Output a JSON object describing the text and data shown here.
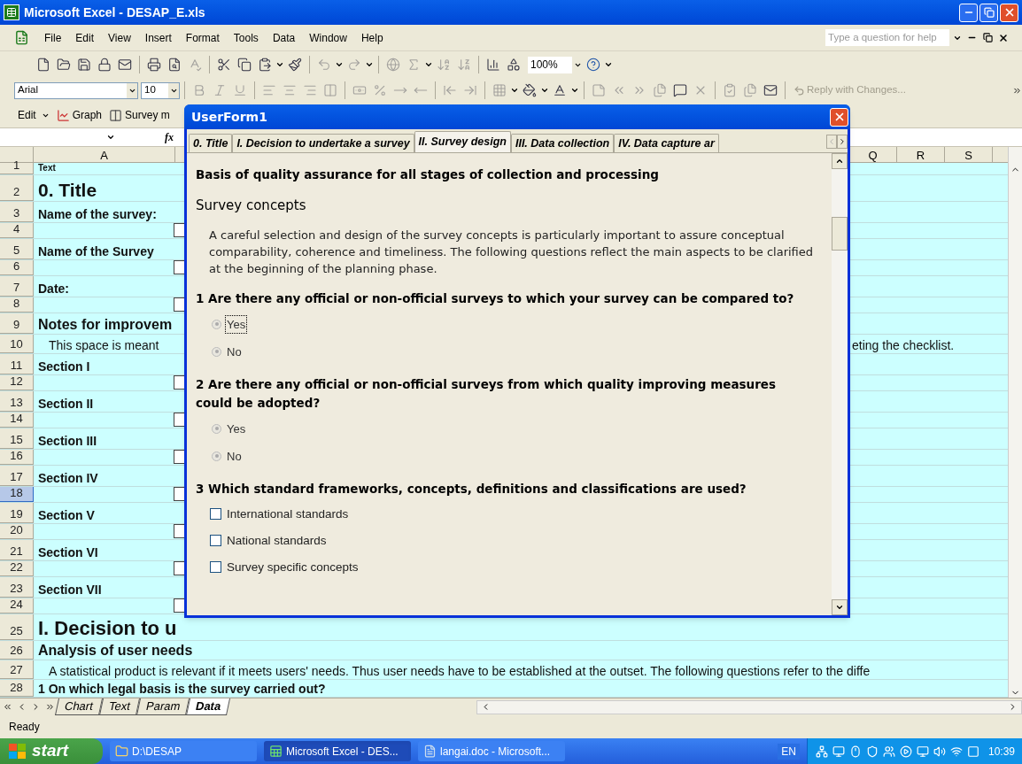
{
  "window": {
    "title": "Microsoft Excel - DESAP_E.xls"
  },
  "menu": [
    "File",
    "Edit",
    "View",
    "Insert",
    "Format",
    "Tools",
    "Data",
    "Window",
    "Help"
  ],
  "help_box": {
    "placeholder": "Type a question for help"
  },
  "standard_toolbar": {
    "zoom": "100%"
  },
  "formatting_toolbar": {
    "font": "Arial",
    "size": "10",
    "review_button": "Reply with Changes..."
  },
  "custom_toolbar": [
    {
      "kind": "menu",
      "label": "Edit"
    },
    {
      "kind": "graph",
      "label": "Graph"
    },
    {
      "kind": "survey",
      "label": "Survey m"
    }
  ],
  "formula_bar": {
    "fx": "fx"
  },
  "columns_left": [
    "A"
  ],
  "columns_right": [
    "Q",
    "R",
    "S"
  ],
  "rows": [
    {
      "number": "1",
      "kind": "small",
      "text": "Text",
      "selected": false
    },
    {
      "number": "2",
      "kind": "title",
      "text": "0. Title",
      "selected": false
    },
    {
      "number": "3",
      "kind": "label",
      "text": "Name of the survey:",
      "selected": false
    },
    {
      "number": "4",
      "kind": "box",
      "checked": false,
      "selected": false
    },
    {
      "number": "5",
      "kind": "label",
      "text": "Name of the Survey",
      "selected": false
    },
    {
      "number": "6",
      "kind": "box",
      "checked": false,
      "selected": false
    },
    {
      "number": "7",
      "kind": "label",
      "text": "Date:",
      "selected": false
    },
    {
      "number": "8",
      "kind": "box",
      "checked": false,
      "selected": false
    },
    {
      "number": "9",
      "kind": "subheading",
      "text": "Notes for improvem",
      "selected": false
    },
    {
      "number": "10",
      "kind": "text",
      "text": "This space is meant",
      "right_text": "eting the checklist.",
      "selected": false
    },
    {
      "number": "11",
      "kind": "label",
      "text": "Section I",
      "selected": false
    },
    {
      "number": "12",
      "kind": "box",
      "checked": false,
      "selected": false
    },
    {
      "number": "13",
      "kind": "label",
      "text": "Section II",
      "selected": false
    },
    {
      "number": "14",
      "kind": "box",
      "checked": false,
      "selected": false
    },
    {
      "number": "15",
      "kind": "label",
      "text": "Section III",
      "selected": false
    },
    {
      "number": "16",
      "kind": "box",
      "checked": false,
      "selected": false
    },
    {
      "number": "17",
      "kind": "label",
      "text": "Section IV",
      "selected": false
    },
    {
      "number": "18",
      "kind": "box",
      "checked": false,
      "selected": true
    },
    {
      "number": "19",
      "kind": "label",
      "text": "Section V",
      "selected": false
    },
    {
      "number": "20",
      "kind": "box",
      "checked": false,
      "selected": false
    },
    {
      "number": "21",
      "kind": "label",
      "text": "Section VI",
      "selected": false
    },
    {
      "number": "22",
      "kind": "box",
      "checked": false,
      "selected": false
    },
    {
      "number": "23",
      "kind": "label",
      "text": "Section VII",
      "selected": false
    },
    {
      "number": "24",
      "kind": "box",
      "checked": false,
      "selected": false
    },
    {
      "number": "25",
      "kind": "section",
      "text": "I. Decision to u",
      "selected": false
    },
    {
      "number": "26",
      "kind": "wide_heading",
      "text": "Analysis of user needs",
      "selected": false
    },
    {
      "number": "27",
      "kind": "wide_text",
      "text": "A statistical product is relevant if it meets users' needs. Thus user needs have to be established at the outset. The following questions refer to the diffe",
      "selected": false
    },
    {
      "number": "28",
      "kind": "wide_question",
      "text": "1 On which legal basis is the survey carried out?",
      "selected": false
    }
  ],
  "dialog": {
    "title": "UserForm1",
    "tabs": [
      {
        "label": "0. Title",
        "selected": false
      },
      {
        "label": "I. Decision to undertake a survey",
        "selected": false
      },
      {
        "label": "II. Survey design",
        "selected": true
      },
      {
        "label": "III. Data collection",
        "selected": false
      },
      {
        "label": "IV. Data capture ar",
        "selected": false
      }
    ],
    "items": [
      {
        "kind": "heading",
        "text": "Basis of quality assurance for all stages of collection and processing"
      },
      {
        "kind": "subheading",
        "text": "Survey concepts"
      },
      {
        "kind": "paragraph",
        "text": "A careful selection and design of the survey concepts is particularly important to assure conceptual comparability, coherence and timeliness. The following questions reflect the main aspects to be clarified at the beginning of the planning phase."
      },
      {
        "kind": "question",
        "text": "1 Are there any official or non-official surveys to which your survey can be compared to?"
      },
      {
        "kind": "radio",
        "label": "Yes",
        "grayed": true,
        "focused": true
      },
      {
        "kind": "radio",
        "label": "No",
        "grayed": true,
        "focused": false
      },
      {
        "kind": "question",
        "text": "2 Are there any official or non-official surveys from which quality improving measures could be adopted?"
      },
      {
        "kind": "radio",
        "label": "Yes",
        "grayed": true,
        "focused": false
      },
      {
        "kind": "radio",
        "label": "No",
        "grayed": true,
        "focused": false
      },
      {
        "kind": "question",
        "text": "3 Which standard frameworks, concepts, definitions and classifications are used?"
      },
      {
        "kind": "checkbox",
        "label": "International standards",
        "checked": false
      },
      {
        "kind": "checkbox",
        "label": "National standards",
        "checked": false
      },
      {
        "kind": "checkbox",
        "label": "Survey specific concepts",
        "checked": false
      }
    ]
  },
  "sheet_tabs": [
    {
      "label": "Chart",
      "selected": false
    },
    {
      "label": "Text",
      "selected": false
    },
    {
      "label": "Param",
      "selected": false
    },
    {
      "label": "Data",
      "selected": true
    }
  ],
  "status_bar": "Ready",
  "taskbar": {
    "start": "start",
    "tasks": [
      {
        "kind": "folder",
        "label": "D:\\DESAP",
        "selected": false
      },
      {
        "kind": "excel",
        "label": "Microsoft Excel - DES...",
        "selected": true
      },
      {
        "kind": "word",
        "label": "langai.doc - Microsoft...",
        "selected": false
      }
    ],
    "language": "EN",
    "clock": "10:39"
  }
}
